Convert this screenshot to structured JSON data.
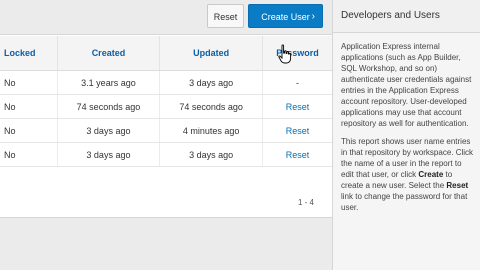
{
  "toolbar": {
    "reset_label": "Reset",
    "create_label": "Create User",
    "create_chevron": "›"
  },
  "table": {
    "headers": [
      "Locked",
      "Created",
      "Updated",
      "Password"
    ],
    "rows": [
      {
        "locked": "No",
        "created": "3.1 years ago",
        "updated": "3 days ago",
        "password": "-"
      },
      {
        "locked": "No",
        "created": "74 seconds ago",
        "updated": "74 seconds ago",
        "password": "Reset"
      },
      {
        "locked": "No",
        "created": "3 days ago",
        "updated": "4 minutes ago",
        "password": "Reset"
      },
      {
        "locked": "No",
        "created": "3 days ago",
        "updated": "3 days ago",
        "password": "Reset"
      }
    ],
    "pagination": "1 - 4"
  },
  "help": {
    "title": "Developers and Users",
    "para1": "Application Express internal applications (such as App Builder, SQL Workshop, and so on) authenticate user credentials against entries in the Application Express account repository. User-developed applications may use that account repository as well for authentication.",
    "para2_a": "This report shows user name entries in that repository by workspace. Click the name of a user in the report to edit that user, or click ",
    "para2_create": "Create",
    "para2_b": " to create a new user. Select the ",
    "para2_reset": "Reset",
    "para2_c": " link to change the password for that user."
  }
}
